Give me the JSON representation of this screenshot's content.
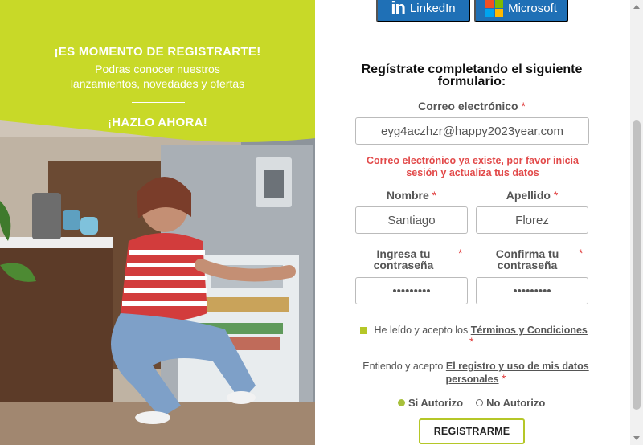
{
  "promo": {
    "heading": "¡ES MOMENTO DE REGISTRARTE!",
    "subtitle_line1": "Podras conocer nuestros",
    "subtitle_line2": "lanzamientos, novedades y ofertas",
    "cta": "¡HAZLO AHORA!"
  },
  "social": {
    "linkedin_label": "LinkedIn",
    "linkedin_logo": "in",
    "microsoft_label": "Microsoft"
  },
  "form": {
    "title": "Regístrate completando el siguiente formulario:",
    "email_label": "Correo electrónico",
    "email_value": "eyg4aczhzr@happy2023year.com",
    "email_error": "Correo electrónico ya existe, por favor inicia sesión y actualiza tus datos",
    "first_name_label": "Nombre",
    "first_name_value": "Santiago",
    "last_name_label": "Apellido",
    "last_name_value": "Florez",
    "password_label": "Ingresa tu contraseña",
    "password_value": "•••••••••",
    "confirm_label": "Confirma tu contraseña",
    "confirm_value": "•••••••••",
    "required_mark": "*",
    "terms_prefix": "He leído y acepto los",
    "terms_link": "Términos y Condiciones",
    "data_prefix": "Entiendo y acepto",
    "data_link": "El registro y uso de mis datos personales",
    "radio_yes": "Si Autorizo",
    "radio_no": "No Autorizo",
    "submit_label": "REGISTRARME"
  },
  "colors": {
    "accent_green": "#b5c728",
    "brand_blue": "#1f70b6",
    "error_red": "#e24a4a"
  }
}
